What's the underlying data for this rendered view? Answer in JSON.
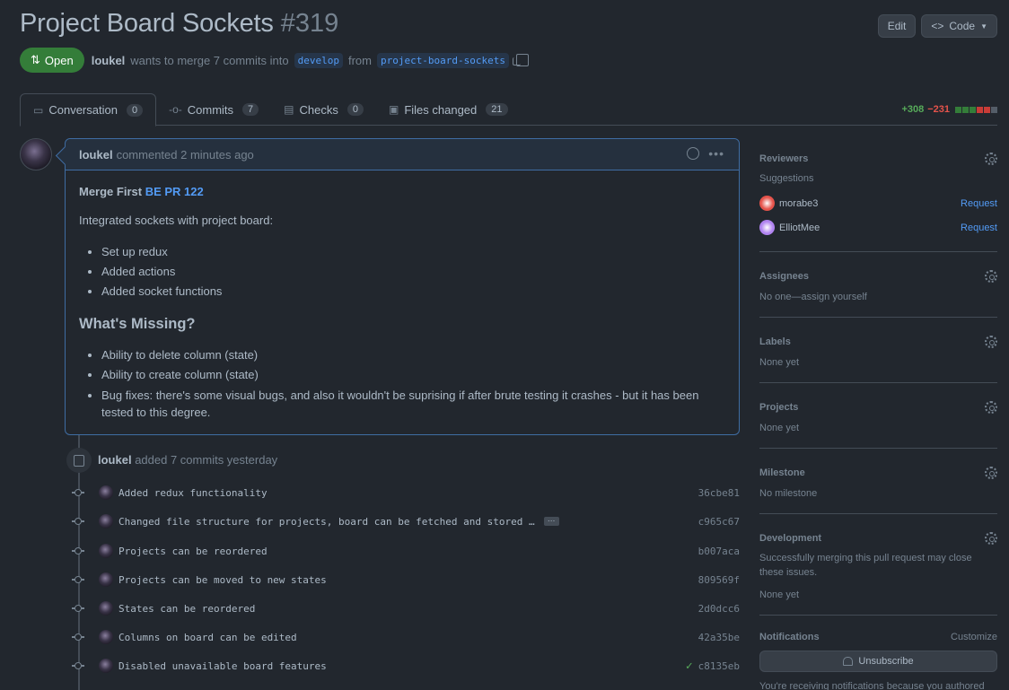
{
  "header": {
    "title": "Project Board Sockets",
    "number": "#319",
    "edit_label": "Edit",
    "code_label": "Code"
  },
  "meta": {
    "state": "Open",
    "author": "loukel",
    "merge_text": "wants to merge 7 commits into",
    "base_branch": "develop",
    "from_text": "from",
    "head_branch": "project-board-sockets"
  },
  "tabs": [
    {
      "label": "Conversation",
      "count": "0"
    },
    {
      "label": "Commits",
      "count": "7"
    },
    {
      "label": "Checks",
      "count": "0"
    },
    {
      "label": "Files changed",
      "count": "21"
    }
  ],
  "diffstat": {
    "additions": "+308",
    "deletions": "−231",
    "colors": [
      "#347d39",
      "#347d39",
      "#347d39",
      "#c93c37",
      "#c93c37",
      "#545d68"
    ]
  },
  "comment": {
    "author": "loukel",
    "time": "commented 2 minutes ago",
    "merge_first_prefix": "Merge First",
    "merge_first_link": "BE PR 122",
    "intro": "Integrated sockets with project board:",
    "done_items": [
      "Set up redux",
      "Added actions",
      "Added socket functions"
    ],
    "missing_heading": "What's Missing?",
    "missing_items": [
      "Ability to delete column (state)",
      "Ability to create column (state)",
      "Bug fixes: there's some visual bugs, and also it wouldn't be suprising if after brute testing it crashes - but it has been tested to this degree."
    ]
  },
  "timeline": {
    "author": "loukel",
    "event_text": "added 7 commits yesterday",
    "commits": [
      {
        "message": "Added redux functionality",
        "sha": "36cbe81"
      },
      {
        "message": "Changed file structure for projects, board can be fetched and stored …",
        "sha": "c965c67"
      },
      {
        "message": "Projects can be reordered",
        "sha": "b007aca"
      },
      {
        "message": "Projects can be moved to new states",
        "sha": "809569f"
      },
      {
        "message": "States can be reordered",
        "sha": "2d0dcc6"
      },
      {
        "message": "Columns on board can be edited",
        "sha": "42a35be"
      },
      {
        "message": "Disabled unavailable board features",
        "sha": "c8135eb"
      }
    ]
  },
  "sidebar": {
    "reviewers_title": "Reviewers",
    "suggestions_label": "Suggestions",
    "reviewers": [
      {
        "name": "morabe3",
        "action": "Request",
        "color": "#e5534b"
      },
      {
        "name": "ElliotMee",
        "action": "Request",
        "color": "#b083f0"
      }
    ],
    "assignees_title": "Assignees",
    "assignees_value": "No one—assign yourself",
    "labels_title": "Labels",
    "labels_value": "None yet",
    "projects_title": "Projects",
    "projects_value": "None yet",
    "milestone_title": "Milestone",
    "milestone_value": "No milestone",
    "development_title": "Development",
    "development_desc": "Successfully merging this pull request may close these issues.",
    "development_value": "None yet",
    "notifications_title": "Notifications",
    "customize_label": "Customize",
    "unsubscribe_label": "Unsubscribe",
    "notifications_note": "You're receiving notifications because you authored the thread."
  }
}
